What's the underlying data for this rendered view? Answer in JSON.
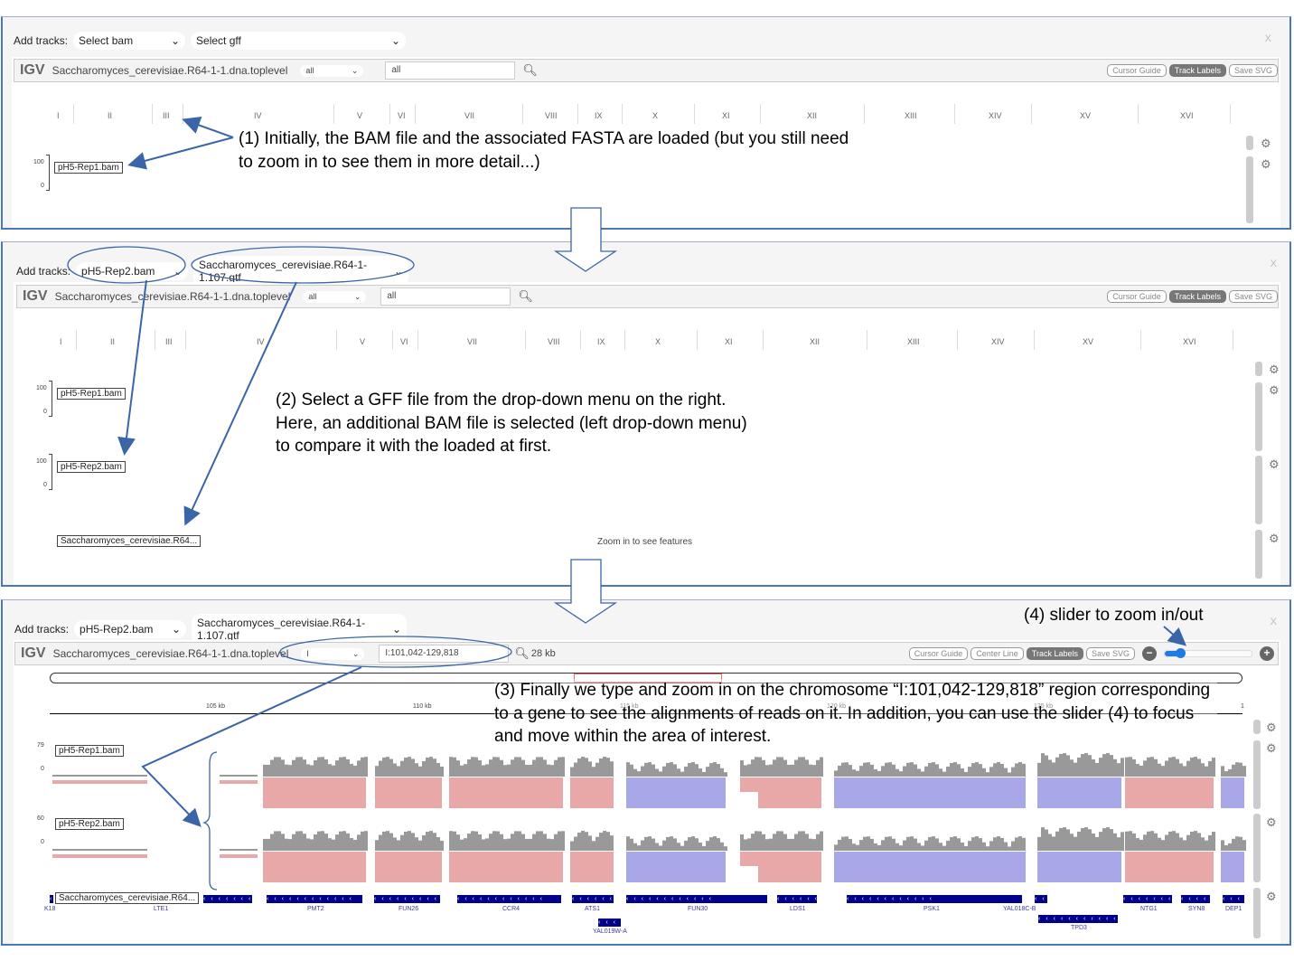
{
  "panel1": {
    "add_tracks": "Add tracks:",
    "bam_select": "Select bam",
    "gff_select": "Select gff",
    "close": "X",
    "igv": "IGV",
    "genome": "Saccharomyces_cerevisiae.R64-1-1.dna.toplevel",
    "chrom_select": "all",
    "locus": "all",
    "buttons": [
      "Cursor Guide",
      "Track Labels",
      "Save SVG"
    ],
    "active_button": "Track Labels",
    "tracks": [
      {
        "label": "pH5-Rep1.bam",
        "max": "100",
        "min": "0"
      }
    ],
    "note": "(1) Initially, the BAM file and the associated FASTA are loaded (but you still need to zoom in to see them in more detail...)"
  },
  "panel2": {
    "add_tracks": "Add tracks:",
    "bam_select": "pH5-Rep2.bam",
    "gff_select": "Saccharomyces_cerevisiae.R64-1-1.107.gtf",
    "close": "X",
    "igv": "IGV",
    "genome": "Saccharomyces_cerevisiae.R64-1-1.dna.toplevel",
    "chrom_select": "all",
    "locus": "all",
    "buttons": [
      "Cursor Guide",
      "Track Labels",
      "Save SVG"
    ],
    "active_button": "Track Labels",
    "tracks": [
      {
        "label": "pH5-Rep1.bam",
        "max": "100",
        "min": "0"
      },
      {
        "label": "pH5-Rep2.bam",
        "max": "100",
        "min": "0"
      }
    ],
    "annotation_track": "Saccharomyces_cerevisiae.R64...",
    "zoom_msg": "Zoom in to see features",
    "note": "(2) Select a GFF file from the drop-down menu on the right. Here, an additional BAM file is selected (left drop-down menu) to compare it with the loaded at first."
  },
  "panel3": {
    "add_tracks": "Add tracks:",
    "bam_select": "pH5-Rep2.bam",
    "gff_select": "Saccharomyces_cerevisiae.R64-1-1.107.gtf",
    "close": "X",
    "igv": "IGV",
    "genome": "Saccharomyces_cerevisiae.R64-1-1.dna.toplevel",
    "chrom_select": "I",
    "locus": "I:101,042-129,818",
    "width": "28 kb",
    "buttons": [
      "Cursor Guide",
      "Center Line",
      "Track Labels",
      "Save SVG"
    ],
    "active_button": "Track Labels",
    "ruler": [
      "105 kb",
      "110 kb",
      "115 kb",
      "120 kb",
      "125 kb"
    ],
    "ruler_end": "1",
    "tracks": [
      {
        "label": "pH5-Rep1.bam",
        "max": "79",
        "min": "0"
      },
      {
        "label": "pH5-Rep2.bam",
        "max": "60",
        "min": "0"
      }
    ],
    "annotation_track": "Saccharomyces_cerevisiae.R64...",
    "genes": [
      "K18",
      "LTE1",
      "PMT2",
      "FUN26",
      "CCR4",
      "ATS1",
      "FUN30",
      "LDS1",
      "PSK1",
      "YAL018C-B",
      "NTG1",
      "SYN8",
      "DEP1",
      "YAL019W-A",
      "TPD3"
    ],
    "zoom_slider": 0.18,
    "note": "(3) Finally we type and zoom in on the chromosome “I:101,042-129,818” region corresponding to a gene to see the alignments of reads on it. In addition, you can use the slider (4) to focus and move within the area of interest.",
    "slider_note": "(4) slider to zoom in/out"
  },
  "chromosomes": [
    "I",
    "II",
    "III",
    "IV",
    "V",
    "VI",
    "VII",
    "VIII",
    "IX",
    "X",
    "XI",
    "XII",
    "XIII",
    "XIV",
    "XV",
    "XVI"
  ],
  "colors": {
    "accent": "#4a78b8",
    "coverage": "#999999",
    "forward_read": "#e8a8a8",
    "reverse_read": "#a8a8e8",
    "gene": "#00008b"
  }
}
